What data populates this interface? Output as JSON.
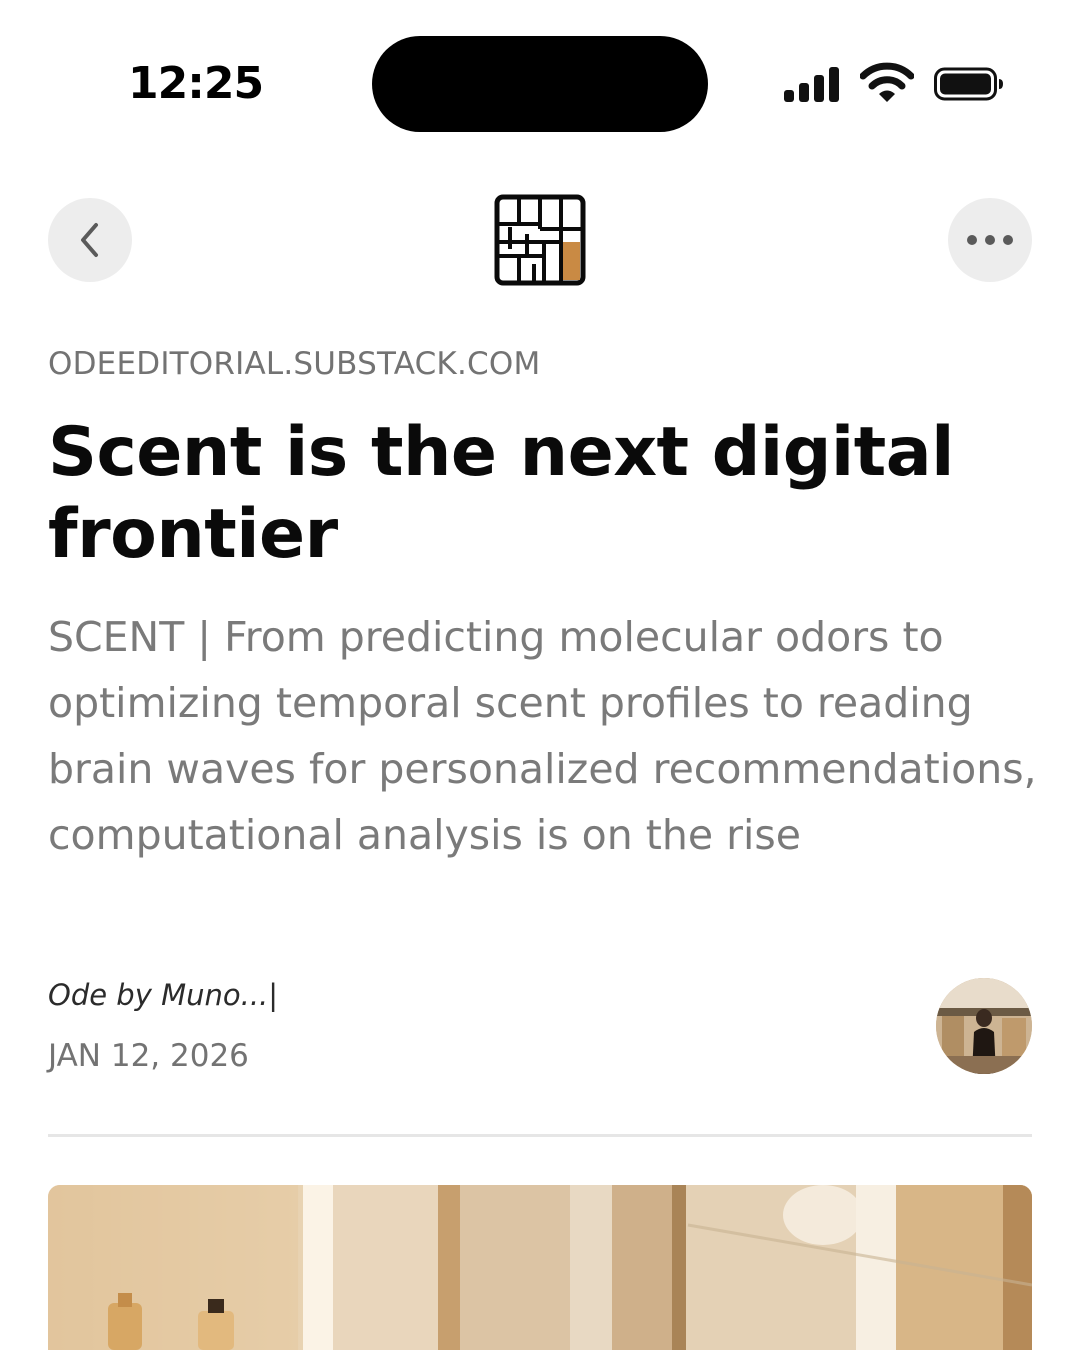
{
  "status_bar": {
    "time": "12:25",
    "icons": [
      "signal-icon",
      "wifi-icon",
      "battery-icon"
    ]
  },
  "nav": {
    "back_icon": "chevron-left-icon",
    "more_icon": "more-horizontal-icon",
    "logo_icon": "publication-logo-icon"
  },
  "article": {
    "domain": "ODEEDITORIAL.SUBSTACK.COM",
    "title": "Scent is the next digital frontier",
    "subtitle": "SCENT | From predicting molecular odors to optimizing temporal scent profiles to reading brain waves for personalized recommendations, computational analysis is on the rise",
    "byline": "Ode by Muno...|",
    "date": "JAN 12, 2026"
  },
  "colors": {
    "background": "#ffffff",
    "title": "#0a0a0a",
    "muted": "#737373",
    "button_bg": "#ededed",
    "logo_accent": "#c98a44"
  }
}
